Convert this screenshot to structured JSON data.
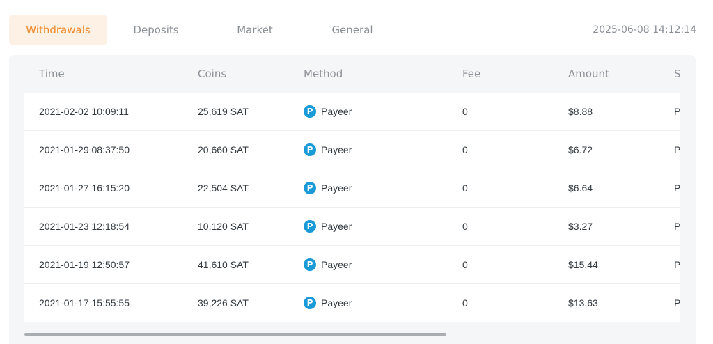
{
  "tabs": [
    {
      "label": "Withdrawals",
      "active": true
    },
    {
      "label": "Deposits",
      "active": false
    },
    {
      "label": "Market",
      "active": false
    },
    {
      "label": "General",
      "active": false
    }
  ],
  "timestamp": "2025-06-08 14:12:14",
  "table": {
    "columns": [
      "Time",
      "Coins",
      "Method",
      "Fee",
      "Amount",
      "S"
    ],
    "rows": [
      {
        "time": "2021-02-02 10:09:11",
        "coins": "25,619 SAT",
        "method": "Payeer",
        "fee": "0",
        "amount": "$8.88",
        "status": "P"
      },
      {
        "time": "2021-01-29 08:37:50",
        "coins": "20,660 SAT",
        "method": "Payeer",
        "fee": "0",
        "amount": "$6.72",
        "status": "P"
      },
      {
        "time": "2021-01-27 16:15:20",
        "coins": "22,504 SAT",
        "method": "Payeer",
        "fee": "0",
        "amount": "$6.64",
        "status": "P"
      },
      {
        "time": "2021-01-23 12:18:54",
        "coins": "10,120 SAT",
        "method": "Payeer",
        "fee": "0",
        "amount": "$3.27",
        "status": "P"
      },
      {
        "time": "2021-01-19 12:50:57",
        "coins": "41,610 SAT",
        "method": "Payeer",
        "fee": "0",
        "amount": "$15.44",
        "status": "P"
      },
      {
        "time": "2021-01-17 15:55:55",
        "coins": "39,226 SAT",
        "method": "Payeer",
        "fee": "0",
        "amount": "$13.63",
        "status": "P"
      }
    ]
  },
  "method_icon": {
    "name": "payeer-icon",
    "glyph": "P",
    "color": "#1a9ad6"
  },
  "colors": {
    "accent": "#f08a2a",
    "accent_bg": "#fdf1e6"
  },
  "scroll": {
    "horizontal_fraction_visible": 0.64
  }
}
